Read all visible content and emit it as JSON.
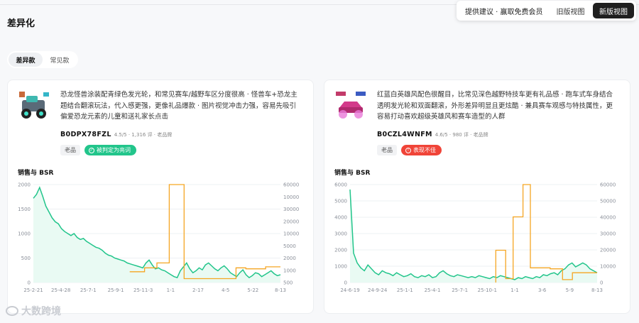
{
  "page": {
    "title": "差异化"
  },
  "topbar": {
    "suggest": "提供建议 · 赢取免费会员",
    "old_view": "旧版视图",
    "new_view": "新版视图"
  },
  "tabs": [
    {
      "label": "差异款"
    },
    {
      "label": "常见款"
    }
  ],
  "watermark": "大数跨境",
  "cards": [
    {
      "description": "恐龙怪兽涂装配青绿色发光轮，和常见赛车/越野车区分度很高 · 怪兽车+恐龙主题结合翻滚玩法，代入感更强，更像礼品爆款 · 图片视觉冲击力强，容易先吸引偏爱恐龙元素的儿童和送礼家长点击",
      "asin": "B0DPX78FZL",
      "meta": "4.5/5 · 1,316 评 · 老品牌",
      "badge1": "老品",
      "badge2": "被判定为亮词",
      "badge2_color": "#22c58b",
      "chart_title": "销售与 BSR",
      "chart_data": {
        "type": "line",
        "x_ticks": [
          "25-2-21",
          "25-4-28",
          "25-7-1",
          "25-9-1",
          "25-11-3",
          "1-1",
          "2-17",
          "4-5",
          "5-22",
          "8-13"
        ],
        "y_left_ticks": [
          "0",
          "500",
          "1000",
          "1500",
          "2000"
        ],
        "y_left_range": [
          0,
          2000
        ],
        "y_right_ticks": [
          "500",
          "1000",
          "2000",
          "5000",
          "10000",
          "20000",
          "30000",
          "10000",
          "60000"
        ],
        "series": [
          {
            "color": "#22c58b",
            "values": [
              1750,
              1900,
              1950,
              1700,
              1500,
              1350,
              1250,
              1200,
              1150,
              1050,
              980,
              1000,
              950,
              900,
              870,
              850,
              820,
              800,
              780,
              760,
              720,
              700,
              680,
              650,
              600,
              560,
              520,
              500,
              480,
              460,
              420,
              400,
              380,
              350,
              330,
              300,
              320,
              340,
              380,
              420,
              450,
              380,
              300,
              250,
              200,
              150,
              120,
              100,
              160,
              220,
              300,
              350,
              380,
              360,
              320,
              300,
              280,
              260,
              250,
              240,
              230,
              220,
              200,
              180,
              160,
              140,
              120,
              100,
              150,
              200,
              250,
              300,
              320,
              260,
              200,
              150,
              120,
              100,
              80,
              60
            ]
          },
          {
            "color": "#f5a623",
            "values": [
              null,
              null,
              null,
              null,
              null,
              null,
              null,
              null,
              null,
              null,
              null,
              null,
              null,
              null,
              null,
              null,
              null,
              null,
              null,
              null,
              null,
              null,
              null,
              null,
              null,
              null,
              null,
              null,
              null,
              null,
              null,
              null,
              null,
              null,
              null,
              null,
              null,
              null,
              null,
              null,
              null,
              null,
              null,
              null,
              null,
              null,
              null,
              null,
              null,
              null,
              null,
              null,
              null,
              null,
              null,
              null,
              null,
              null,
              null,
              null,
              null,
              null,
              null,
              null,
              null,
              null,
              null,
              null,
              null,
              null,
              null,
              null,
              null,
              null,
              null,
              null,
              null,
              null,
              null,
              null
            ]
          }
        ]
      }
    },
    {
      "description": "红蓝白英雄风配色很醒目，比常见深色越野特技车更有礼品感 · 跑车式车身结合透明发光轮和双面翻滚，外形差异明显且更炫酷 · 兼具赛车观感与特技属性，更容易打动喜欢超级英雄风和赛车造型的人群",
      "asin": "B0CZL4WNFM",
      "meta": "4.6/5 · 980 评 · 老品牌",
      "badge1": "老品",
      "badge2": "表现不佳",
      "badge2_color": "#f04438",
      "chart_title": "销售与 BSR",
      "chart_data": {
        "type": "line",
        "x_ticks": [
          "24-6-19",
          "24-9-24",
          "25-1-1",
          "25-4-1",
          "25-7-1",
          "25-10-1",
          "1-1",
          "3-6",
          "5-9",
          "8-13"
        ],
        "y_left_ticks": [
          "0",
          "1000",
          "2000",
          "3000",
          "4000",
          "5000",
          "6000"
        ],
        "y_left_range": [
          0,
          6000
        ],
        "y_right_ticks": [
          "0",
          "10000",
          "20000",
          "30000",
          "40000",
          "50000",
          "60000"
        ],
        "series": [
          {
            "color": "#22c58b"
          },
          {
            "color": "#f5a623"
          }
        ]
      }
    }
  ]
}
